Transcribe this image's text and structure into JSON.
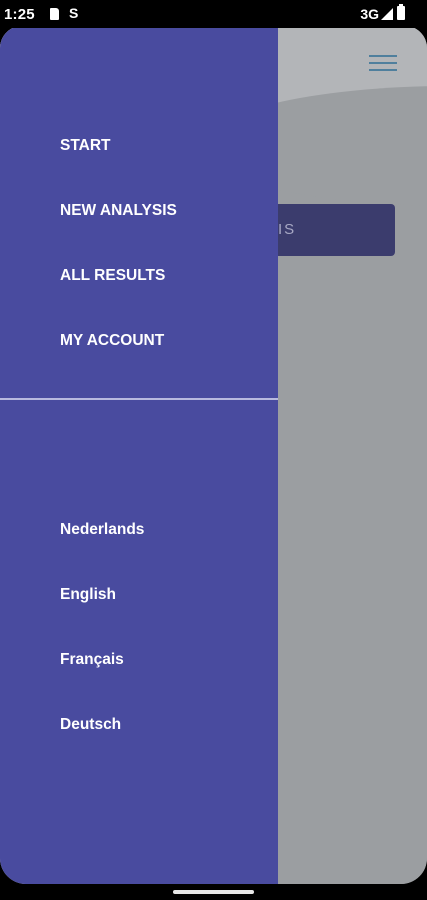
{
  "status_bar": {
    "time": "1:25",
    "network": "3G",
    "sd_icon": "sd-card-icon",
    "s_icon": "S"
  },
  "drawer": {
    "nav_items": [
      {
        "label": "START"
      },
      {
        "label": "NEW ANALYSIS"
      },
      {
        "label": "ALL RESULTS"
      },
      {
        "label": "MY ACCOUNT"
      }
    ],
    "languages": [
      {
        "label": "Nederlands"
      },
      {
        "label": "English"
      },
      {
        "label": "Français"
      },
      {
        "label": "Deutsch"
      }
    ]
  },
  "background_app": {
    "button_label_fragment": "IS"
  },
  "colors": {
    "drawer_bg": "#494b9f",
    "scrim": "#9b9ea1",
    "button_bg": "#3b3c6d",
    "menu_icon": "#4f7f9d"
  }
}
